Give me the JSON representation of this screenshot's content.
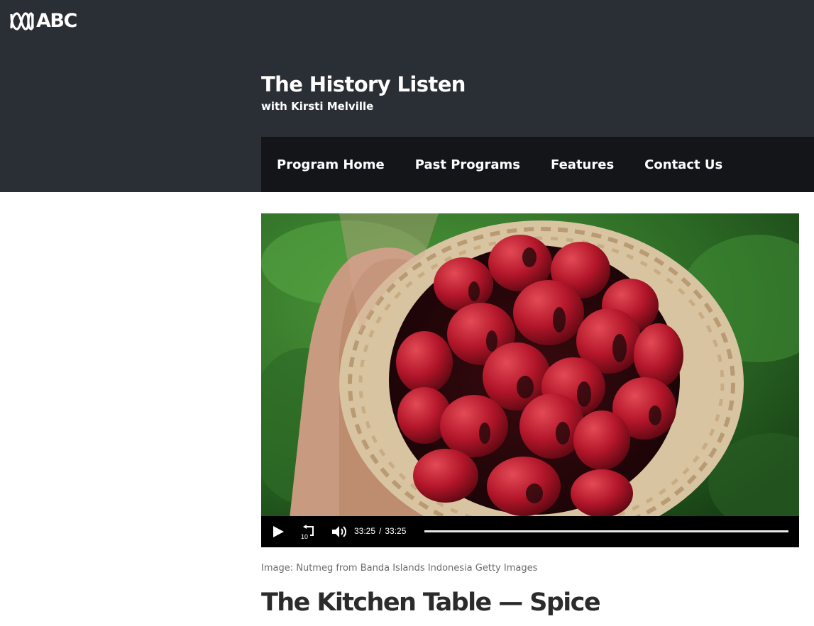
{
  "brand": {
    "name": "ABC",
    "logo_icon": "abc-lissajous-logo"
  },
  "program": {
    "title": "The History Listen",
    "host": "with Kirsti Melville"
  },
  "nav": {
    "items": [
      {
        "label": "Program Home"
      },
      {
        "label": "Past Programs"
      },
      {
        "label": "Features"
      },
      {
        "label": "Contact Us"
      }
    ]
  },
  "player": {
    "image_subject": "hand holding a woven basket of red nutmeg fruits",
    "play_icon": "play-icon",
    "replay_icon": "replay-10-icon",
    "replay_label": "10",
    "volume_icon": "volume-icon",
    "current_time": "33:25",
    "time_separator": "/",
    "duration": "33:25",
    "progress": 1.0
  },
  "caption": "Image: Nutmeg from Banda Islands Indonesia Getty Images",
  "episode": {
    "title": "The Kitchen Table — Spice"
  },
  "colors": {
    "header_bg": "#2a2e35",
    "nav_bg": "#131518",
    "text_dark": "#2b2b2b",
    "caption_gray": "#6b6b6b"
  }
}
